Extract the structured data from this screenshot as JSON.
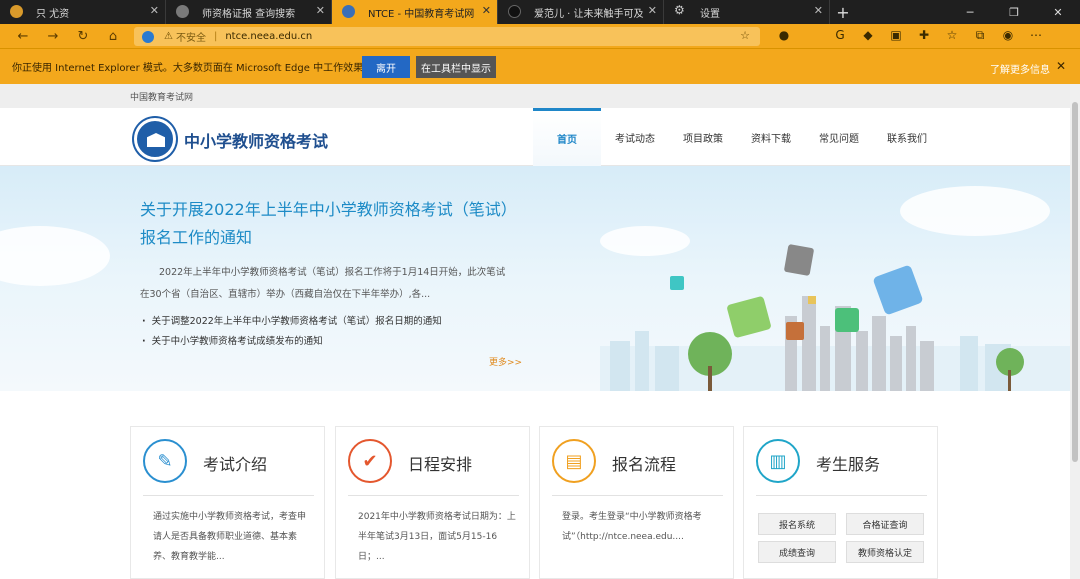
{
  "browser": {
    "tabs": [
      {
        "title": "只 尤资",
        "active": false,
        "favicon_color": "#d99a2b"
      },
      {
        "title": "师资格证报 查询搜索",
        "active": false,
        "favicon_color": "#7a7a7a"
      },
      {
        "title": "NTCE - 中国教育考试网",
        "active": true,
        "favicon_color": "#3a6fb7"
      },
      {
        "title": "爱范儿 · 让未来触手可及",
        "active": false,
        "favicon_color": "#111111"
      },
      {
        "title": "设置",
        "active": false,
        "favicon_color": "#aaaaaa"
      }
    ],
    "new_tab": "+",
    "address": {
      "insecure_label": "不安全",
      "url": "ntce.neea.edu.cn"
    },
    "ie_bar": {
      "message": "你正使用 Internet Explorer 模式。大多数页面在 Microsoft Edge 中工作效果更佳。",
      "leave_label": "离开",
      "show_in_toolbar_label": "在工具栏中显示",
      "learn_more": "了解更多信息"
    },
    "accent_color": "#f3a81c"
  },
  "site": {
    "breadcrumb": "中国教育考试网",
    "title": "中小学教师资格考试",
    "nav": [
      {
        "label": "首页",
        "active": true
      },
      {
        "label": "考试动态",
        "active": false
      },
      {
        "label": "项目政策",
        "active": false
      },
      {
        "label": "资料下载",
        "active": false
      },
      {
        "label": "常见问题",
        "active": false
      },
      {
        "label": "联系我们",
        "active": false
      }
    ],
    "brand_color": "#1f86c8"
  },
  "banner": {
    "title": "关于开展2022年上半年中小学教师资格考试（笔试）报名工作的通知",
    "summary": "2022年上半年中小学教师资格考试（笔试）报名工作将于1月14日开始，此次笔试在30个省（自治区、直辖市）举办（西藏自治仅在下半年举办）,各...",
    "links": [
      "关于调整2022年上半年中小学教师资格考试（笔试）报名日期的通知",
      "关于中小学教师资格考试成绩发布的通知"
    ],
    "more": "更多>>"
  },
  "cards": [
    {
      "title": "考试介绍",
      "text": "通过实施中小学教师资格考试，考查申请人是否具备教师职业道德、基本素养、教育教学能...",
      "icon": "document-edit-icon",
      "color": "#2a8fd0"
    },
    {
      "title": "日程安排",
      "text": "2021年中小学教师资格考试日期为：上半年笔试3月13日，面试5月15-16日；...",
      "icon": "checkmark-icon",
      "color": "#e4572e"
    },
    {
      "title": "报名流程",
      "text": "登录。考生登录“中小学教师资格考试”（http://ntce.neea.edu....",
      "icon": "form-icon",
      "color": "#f0a020"
    },
    {
      "title": "考生服务",
      "icon": "address-book-icon",
      "color": "#1fa5c8",
      "buttons": [
        "报名系统",
        "合格证查询",
        "成绩查询",
        "教师资格认定"
      ]
    }
  ]
}
